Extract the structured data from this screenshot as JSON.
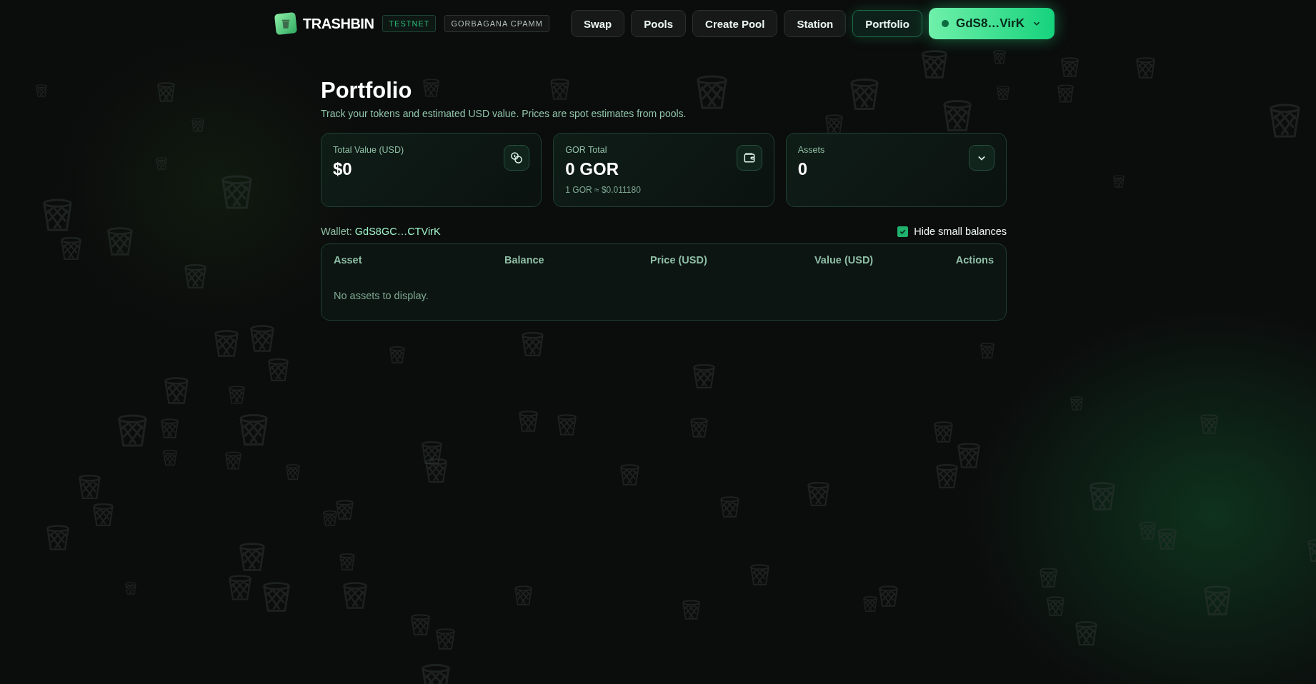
{
  "header": {
    "logo": "TRASHBIN",
    "badges": [
      {
        "label": "TESTNET",
        "kind": "network"
      },
      {
        "label": "GORBAGANA CPAMM",
        "kind": "plain"
      }
    ],
    "nav": [
      {
        "label": "Swap",
        "selected": false
      },
      {
        "label": "Pools",
        "selected": false
      },
      {
        "label": "Create Pool",
        "selected": false
      },
      {
        "label": "Station",
        "selected": false
      },
      {
        "label": "Portfolio",
        "selected": true
      }
    ],
    "wallet_button": {
      "label": "GdS8…VirK",
      "connected": true
    }
  },
  "page": {
    "title": "Portfolio",
    "subtitle": "Track your tokens and estimated USD value. Prices are spot estimates from pools."
  },
  "cards": [
    {
      "label": "Total Value (USD)",
      "value": "$0",
      "kind": "coins"
    },
    {
      "label": "GOR Total",
      "value": "0 GOR",
      "note": "1 GOR ≈ $0.011180",
      "kind": "wallet"
    },
    {
      "label": "Assets",
      "value": "0",
      "kind": "expand"
    }
  ],
  "wallet_row": {
    "label": "Wallet:",
    "address": "GdS8GC…CTVirK",
    "hide_small_balances": {
      "label": "Hide small balances",
      "checked": true
    }
  },
  "table": {
    "columns": [
      "Asset",
      "Balance",
      "Price (USD)",
      "Value (USD)",
      "Actions"
    ],
    "empty_message": "No assets to display."
  }
}
